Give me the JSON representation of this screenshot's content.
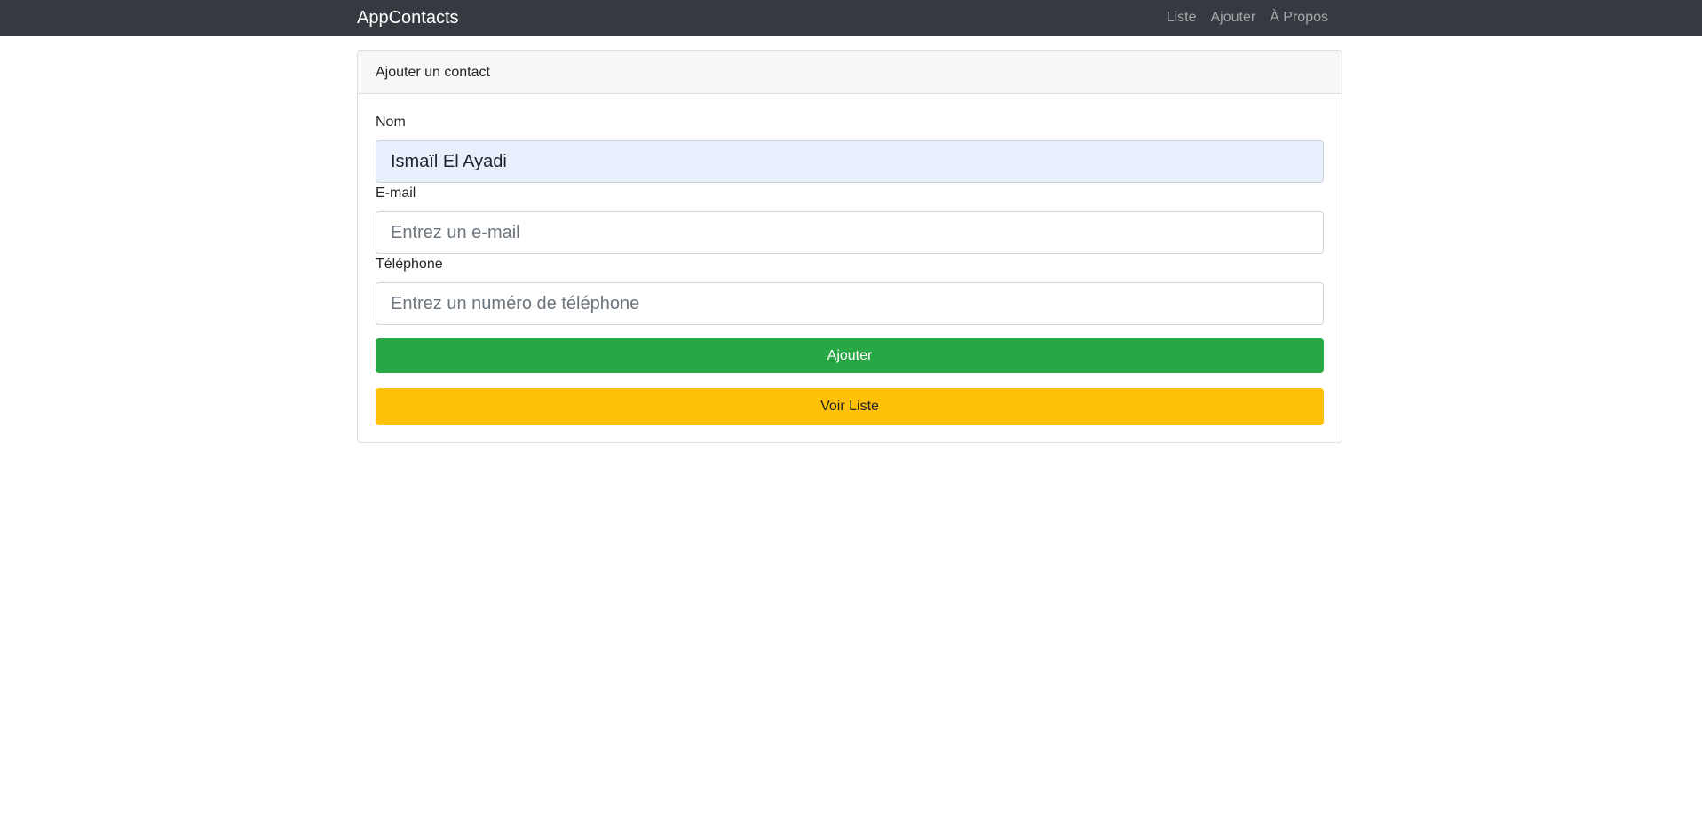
{
  "navbar": {
    "brand": "AppContacts",
    "links": [
      "Liste",
      "Ajouter",
      "À Propos"
    ]
  },
  "card": {
    "header": "Ajouter un contact",
    "fields": {
      "nom": {
        "label": "Nom",
        "value": "Ismaïl El Ayadi",
        "placeholder": ""
      },
      "email": {
        "label": "E-mail",
        "value": "",
        "placeholder": "Entrez un e-mail"
      },
      "telephone": {
        "label": "Téléphone",
        "value": "",
        "placeholder": "Entrez un numéro de téléphone"
      }
    },
    "buttons": {
      "add": "Ajouter",
      "view_list": "Voir Liste"
    }
  },
  "colors": {
    "navbar_bg": "#343a40",
    "success": "#28a745",
    "warning": "#ffc107",
    "autofill_bg": "#e8f0fe"
  }
}
